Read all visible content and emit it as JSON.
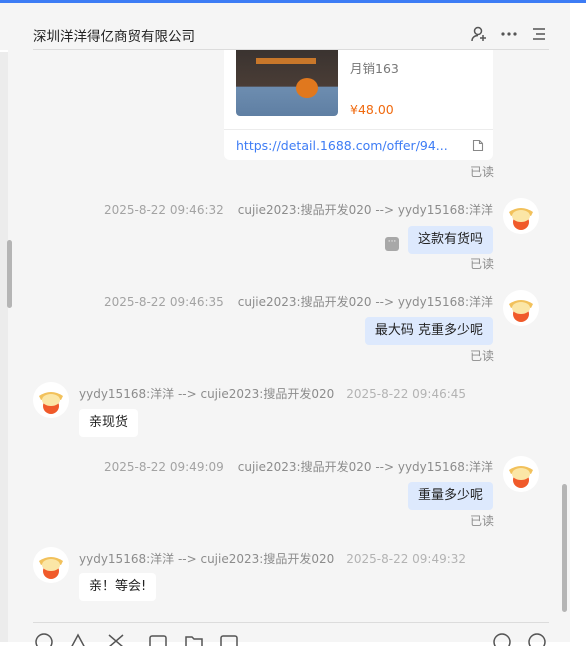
{
  "header": {
    "title": "深圳洋洋得亿商贸有限公司",
    "icons": [
      "add-user-icon",
      "more-icon",
      "list-icon"
    ]
  },
  "product_card": {
    "sales": "月销163",
    "price": "¥48.00",
    "link": "https://detail.1688.com/offer/94..."
  },
  "messages": [
    {
      "direction": "status",
      "status": "已读"
    },
    {
      "direction": "outgoing",
      "time": "2025-8-22 09:46:32",
      "route": "cujie2023:搜品开发020 --> yydy15168:洋洋",
      "text": "这款有货吗",
      "status": "已读"
    },
    {
      "direction": "outgoing",
      "time": "2025-8-22 09:46:35",
      "route": "cujie2023:搜品开发020 --> yydy15168:洋洋",
      "text": "最大码 克重多少呢",
      "status": "已读"
    },
    {
      "direction": "incoming",
      "route": "yydy15168:洋洋 --> cujie2023:搜品开发020",
      "time": "2025-8-22 09:46:45",
      "text": "亲现货"
    },
    {
      "direction": "outgoing",
      "time": "2025-8-22 09:49:09",
      "route": "cujie2023:搜品开发020 --> yydy15168:洋洋",
      "text": "重量多少呢",
      "status": "已读"
    },
    {
      "direction": "incoming",
      "route": "yydy15168:洋洋 --> cujie2023:搜品开发020",
      "time": "2025-8-22 09:49:32",
      "text": "亲！等会!"
    }
  ],
  "toolbar": {
    "icons": [
      "emoji-icon",
      "triangle-icon",
      "scissors-icon",
      "image-icon",
      "folder-icon",
      "video-icon",
      "history-icon",
      "settings-icon"
    ]
  },
  "colors": {
    "accent": "#3d7cf5",
    "price": "#f06a0f",
    "outgoing_bubble": "#dde9fd",
    "chat_background": "#f5f5f5"
  }
}
